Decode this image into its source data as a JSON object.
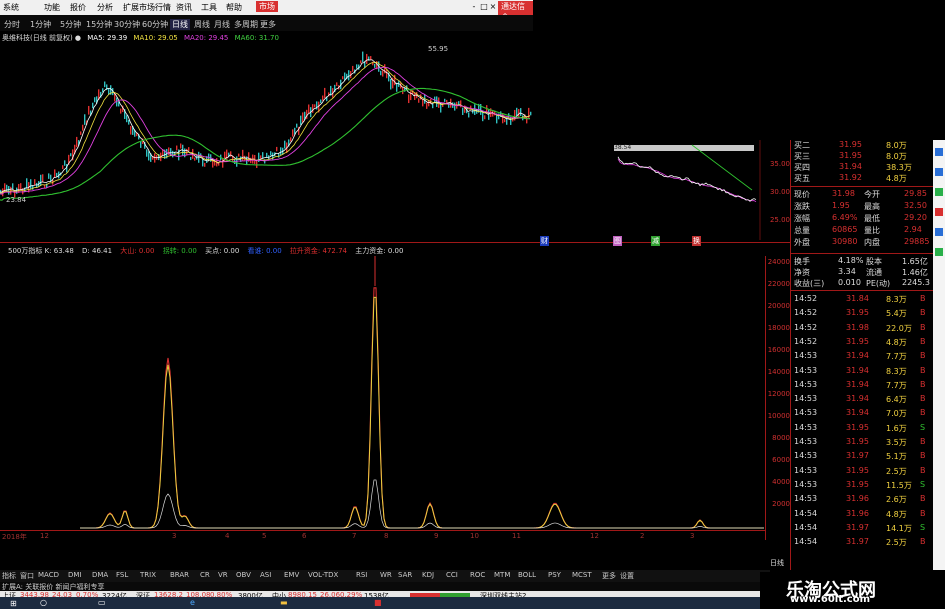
{
  "menu": {
    "items": [
      "系统",
      "功能",
      "报价",
      "分析",
      "扩展市场行情",
      "资讯",
      "工具",
      "帮助"
    ],
    "market_tag": "市场",
    "right_tag": "通达信金",
    "win_controls": [
      "-",
      "□",
      "×"
    ]
  },
  "periods": {
    "items": [
      "分时",
      "1分钟",
      "5分钟",
      "15分钟",
      "30分钟",
      "60分钟",
      "日线",
      "周线",
      "月线",
      "多周期",
      "更多"
    ],
    "active": "日线"
  },
  "ma_bar": {
    "stock": "奥维科技(日线 前复权)",
    "items": [
      {
        "label": "MA5: 29.39",
        "color": "#ffffff"
      },
      {
        "label": "MA10: 29.05",
        "color": "#f0e040"
      },
      {
        "label": "MA20: 29.45",
        "color": "#e040e0"
      },
      {
        "label": "MA60: 31.70",
        "color": "#40d040"
      }
    ],
    "high_label": "55.95",
    "low_label": "23.84"
  },
  "price_axis": [
    "35.00",
    "30.00",
    "25.00"
  ],
  "mini_label": "38.54",
  "indicator_bar": {
    "items": [
      {
        "label": "500万指标 K: 63.48",
        "color": "#dddddd"
      },
      {
        "label": "D: 46.41",
        "color": "#dddddd"
      },
      {
        "label": "大山: 0.00",
        "color": "#e03030"
      },
      {
        "label": "拐转: 0.00",
        "color": "#30c030"
      },
      {
        "label": "买点: 0.00",
        "color": "#dddddd"
      },
      {
        "label": "看谁: 0.00",
        "color": "#3060ff"
      },
      {
        "label": "拉升资金: 472.74",
        "color": "#e03030"
      },
      {
        "label": "主力资金: 0.00",
        "color": "#dddddd"
      }
    ]
  },
  "event_tags": [
    "财",
    "图",
    "减",
    "换"
  ],
  "indicator_axis": [
    "24000",
    "22000",
    "20000",
    "18000",
    "16000",
    "14000",
    "12000",
    "10000",
    "8000",
    "6000",
    "4000",
    "2000"
  ],
  "x_axis": [
    "2018年",
    "12",
    "3",
    "4",
    "5",
    "6",
    "7",
    "8",
    "9",
    "10",
    "11",
    "12",
    "2",
    "3"
  ],
  "order_book": [
    {
      "label": "买二",
      "price": "31.95",
      "vol": "8.0万"
    },
    {
      "label": "买三",
      "price": "31.95",
      "vol": "8.0万"
    },
    {
      "label": "买四",
      "price": "31.94",
      "vol": "38.3万"
    },
    {
      "label": "买五",
      "price": "31.92",
      "vol": "4.8万"
    }
  ],
  "quote": [
    {
      "l": "现价",
      "v": "31.98",
      "l2": "今开",
      "v2": "29.85"
    },
    {
      "l": "涨跌",
      "v": "1.95",
      "l2": "最高",
      "v2": "32.50"
    },
    {
      "l": "涨幅",
      "v": "6.49%",
      "l2": "最低",
      "v2": "29.20"
    },
    {
      "l": "总量",
      "v": "60865",
      "l2": "量比",
      "v2": "2.94"
    },
    {
      "l": "外盘",
      "v": "30980",
      "l2": "内盘",
      "v2": "29885"
    }
  ],
  "fundamentals": [
    {
      "l": "换手",
      "v": "4.18%",
      "l2": "股本",
      "v2": "1.65亿"
    },
    {
      "l": "净资",
      "v": "3.34",
      "l2": "流通",
      "v2": "1.46亿"
    },
    {
      "l": "收益(三)",
      "v": "0.010",
      "l2": "PE(动)",
      "v2": "2245.3"
    }
  ],
  "ticks": [
    {
      "t": "14:52",
      "p": "31.84",
      "v": "8.3万",
      "d": "B"
    },
    {
      "t": "14:52",
      "p": "31.95",
      "v": "5.4万",
      "d": "B"
    },
    {
      "t": "14:52",
      "p": "31.98",
      "v": "22.0万",
      "d": "B"
    },
    {
      "t": "14:52",
      "p": "31.95",
      "v": "4.8万",
      "d": "B"
    },
    {
      "t": "14:53",
      "p": "31.94",
      "v": "7.7万",
      "d": "B"
    },
    {
      "t": "14:53",
      "p": "31.94",
      "v": "8.3万",
      "d": "B"
    },
    {
      "t": "14:53",
      "p": "31.94",
      "v": "7.7万",
      "d": "B"
    },
    {
      "t": "14:53",
      "p": "31.94",
      "v": "6.4万",
      "d": "B"
    },
    {
      "t": "14:53",
      "p": "31.94",
      "v": "7.0万",
      "d": "B"
    },
    {
      "t": "14:53",
      "p": "31.95",
      "v": "1.6万",
      "d": "S"
    },
    {
      "t": "14:53",
      "p": "31.95",
      "v": "3.5万",
      "d": "B"
    },
    {
      "t": "14:53",
      "p": "31.97",
      "v": "5.1万",
      "d": "B"
    },
    {
      "t": "14:53",
      "p": "31.95",
      "v": "2.5万",
      "d": "B"
    },
    {
      "t": "14:53",
      "p": "31.95",
      "v": "11.5万",
      "d": "S"
    },
    {
      "t": "14:53",
      "p": "31.96",
      "v": "2.6万",
      "d": "B"
    },
    {
      "t": "14:54",
      "p": "31.96",
      "v": "4.8万",
      "d": "B"
    },
    {
      "t": "14:54",
      "p": "31.97",
      "v": "14.1万",
      "d": "S"
    },
    {
      "t": "14:54",
      "p": "31.97",
      "v": "2.5万",
      "d": "B"
    }
  ],
  "tabs": [
    "指标",
    "窗口",
    "MACD",
    "DMI",
    "DMA",
    "FSL",
    "TRIX",
    "BRAR",
    "CR",
    "VR",
    "OBV",
    "ASI",
    "EMV",
    "VOL-TDX",
    "RSI",
    "WR",
    "SAR",
    "KDJ",
    "CCI",
    "ROC",
    "MTM",
    "BOLL",
    "PSY",
    "MCST",
    "更多",
    "设置"
  ],
  "extension": "扩展A: 关联报价  新闻户福利专享",
  "right_tab": "日线",
  "status": {
    "sh": {
      "name": "上证",
      "value": "3443.98",
      "chg": "24.03",
      "pct": "0.70%",
      "amt": "3224亿"
    },
    "sz": {
      "name": "深证",
      "value": "13628.2",
      "chg": "108.08",
      "pct": "0.80%",
      "amt": "3800亿"
    },
    "zx": {
      "name": "中小",
      "value": "8980.15",
      "chg": "26.06",
      "pct": "0.29%",
      "amt": "1538亿"
    },
    "news": "深圳双线主站2"
  },
  "watermark": {
    "title": "乐淘公式网",
    "url": "www.60lt.com"
  },
  "colors": {
    "up": "#e03030",
    "down": "#30c030",
    "axis": "#a01818",
    "bg": "#000000"
  }
}
